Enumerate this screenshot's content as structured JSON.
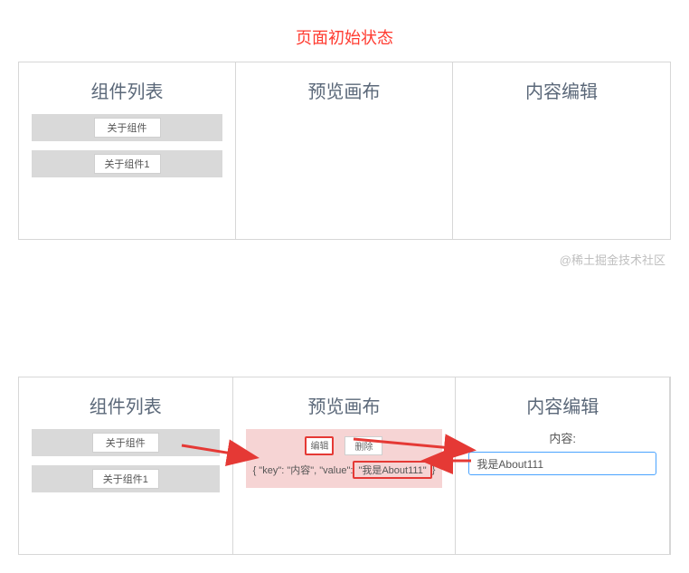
{
  "title_initial": "页面初始状态",
  "columns": {
    "list": "组件列表",
    "preview": "预览画布",
    "editor": "内容编辑"
  },
  "components": [
    {
      "name": "关于组件"
    },
    {
      "name": "关于组件1"
    }
  ],
  "preview": {
    "edit_btn": "编辑",
    "delete_btn": "删除",
    "json_prefix": "{ \"key\": \"内容\", \"value\": ",
    "json_value": "\"我是About111\"",
    "json_suffix": " }"
  },
  "editor": {
    "field_label": "内容:",
    "input_value": "我是About111"
  },
  "watermark": "@稀土掘金技术社区"
}
